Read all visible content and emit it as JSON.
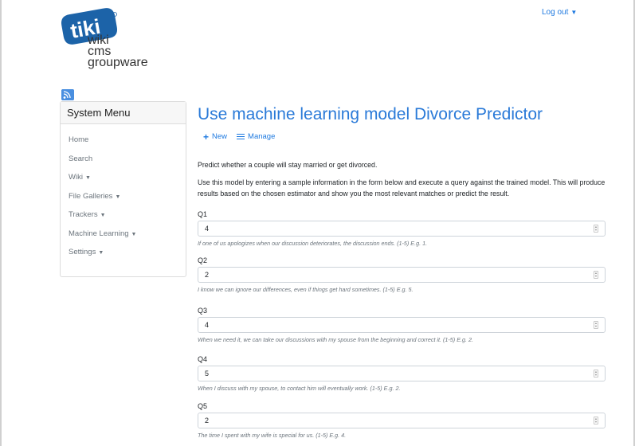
{
  "header": {
    "logo_text": [
      "wiki",
      "cms",
      "groupware"
    ],
    "logout_label": "Log out"
  },
  "sidebar": {
    "title": "System Menu",
    "items": [
      {
        "label": "Home",
        "dropdown": false
      },
      {
        "label": "Search",
        "dropdown": false
      },
      {
        "label": "Wiki",
        "dropdown": true
      },
      {
        "label": "File Galleries",
        "dropdown": true
      },
      {
        "label": "Trackers",
        "dropdown": true
      },
      {
        "label": "Machine Learning",
        "dropdown": true
      },
      {
        "label": "Settings",
        "dropdown": true
      }
    ]
  },
  "main": {
    "title": "Use machine learning model Divorce Predictor",
    "actions": {
      "new_label": "New",
      "manage_label": "Manage"
    },
    "description1": "Predict whether a couple will stay married or get divorced.",
    "description2": "Use this model by entering a sample information in the form below and execute a query against the trained model. This will produce results based on the chosen estimator and show you the most relevant matches or predict the result.",
    "fields": [
      {
        "label": "Q1",
        "value": "4",
        "help": "If one of us apologizes when our discussion deteriorates, the discussion ends. (1-5) E.g. 1."
      },
      {
        "label": "Q2",
        "value": "2",
        "help": "I know we can ignore our differences, even if things get hard sometimes. (1-5) E.g. 5."
      },
      {
        "label": "Q3",
        "value": "4",
        "help": "When we need it, we can take our discussions with my spouse from the beginning and correct it. (1-5) E.g. 2."
      },
      {
        "label": "Q4",
        "value": "5",
        "help": "When I discuss with my spouse, to contact him will eventually work. (1-5) E.g. 2."
      },
      {
        "label": "Q5",
        "value": "2",
        "help": "The time I spent with my wife is special for us. (1-5) E.g. 4."
      }
    ]
  },
  "colors": {
    "accent": "#2a7ad8",
    "link": "#1f7ae0",
    "muted": "#6c757d"
  }
}
